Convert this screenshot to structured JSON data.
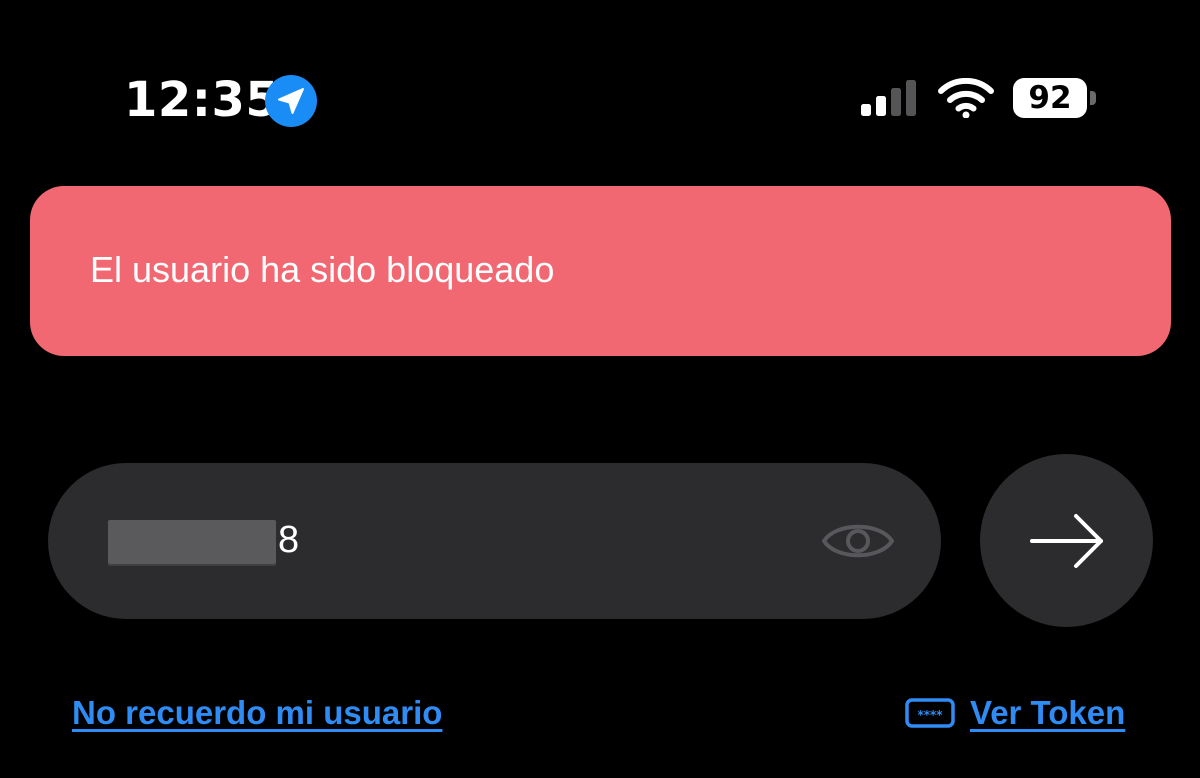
{
  "status_bar": {
    "time": "12:35",
    "battery_level": "92",
    "signal_bars_active": 2,
    "signal_bars_total": 4,
    "icons": [
      "location-arrow-icon",
      "signal-icon",
      "wifi-icon",
      "battery-icon"
    ]
  },
  "alert": {
    "message": "El usuario ha sido bloqueado",
    "color": "#f26872"
  },
  "login": {
    "username_visible_suffix": "8",
    "username_redacted": true,
    "toggle_icon": "eye-icon",
    "submit_icon": "arrow-right-icon"
  },
  "links": {
    "forgot_username": "No recuerdo mi usuario",
    "view_token": "Ver Token",
    "view_token_icon": "password-field-icon",
    "color": "#2f8cf5"
  }
}
